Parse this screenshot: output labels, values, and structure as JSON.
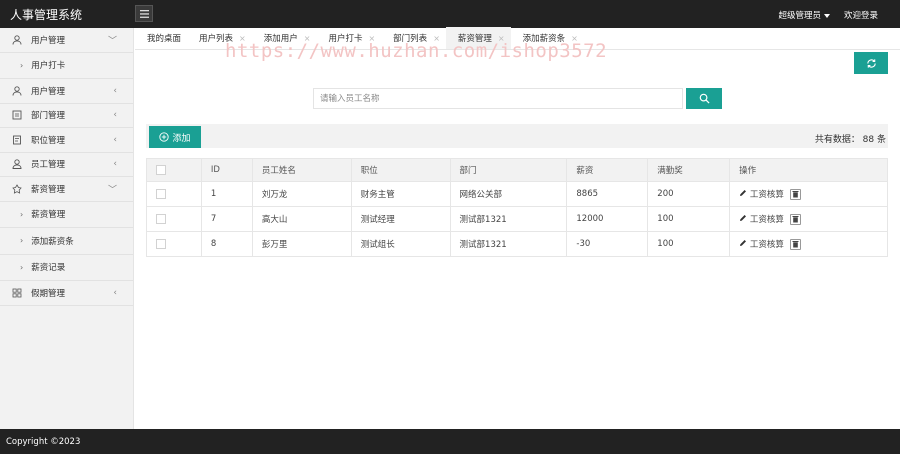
{
  "app": {
    "title": "人事管理系统"
  },
  "topbar": {
    "user_label": "超级管理员",
    "welcome_label": "欢迎登录"
  },
  "sidebar": {
    "items": [
      {
        "label": "用户管理",
        "icon": "user-icon",
        "expanded": true
      },
      {
        "label": "用户打卡",
        "sub": true
      },
      {
        "label": "用户管理",
        "icon": "user-icon",
        "expanded": false
      },
      {
        "label": "部门管理",
        "icon": "department-icon",
        "expanded": false
      },
      {
        "label": "职位管理",
        "icon": "position-icon",
        "expanded": false
      },
      {
        "label": "员工管理",
        "icon": "employee-icon",
        "expanded": false
      },
      {
        "label": "薪资管理",
        "icon": "salary-icon",
        "expanded": true
      },
      {
        "label": "薪资管理",
        "sub": true
      },
      {
        "label": "添加薪资条",
        "sub": true
      },
      {
        "label": "薪资记录",
        "sub": true
      },
      {
        "label": "假期管理",
        "icon": "grid-icon",
        "expanded": false
      }
    ]
  },
  "tabs": [
    {
      "label": "我的桌面",
      "closable": false
    },
    {
      "label": "用户列表",
      "closable": true
    },
    {
      "label": "添加用户",
      "closable": true
    },
    {
      "label": "用户打卡",
      "closable": true
    },
    {
      "label": "部门列表",
      "closable": true
    },
    {
      "label": "薪资管理",
      "closable": true,
      "active": true
    },
    {
      "label": "添加薪资条",
      "closable": true
    }
  ],
  "tab_close_glyph": "×",
  "watermark": "https://www.huzhan.com/ishop3572",
  "search": {
    "placeholder": "请输入员工名称"
  },
  "toolbar": {
    "add_label": "添加",
    "total_label": "共有数据： 88 条"
  },
  "table": {
    "headers": [
      "",
      "ID",
      "员工姓名",
      "职位",
      "部门",
      "薪资",
      "满勤奖",
      "操作"
    ],
    "rows": [
      {
        "id": "1",
        "name": "刘万龙",
        "position": "财务主管",
        "department": "网络公关部",
        "salary": "8865",
        "bonus": "200",
        "action": "工资核算"
      },
      {
        "id": "7",
        "name": "高大山",
        "position": "测试经理",
        "department": "测试部1321",
        "salary": "12000",
        "bonus": "100",
        "action": "工资核算"
      },
      {
        "id": "8",
        "name": "彭万里",
        "position": "测试组长",
        "department": "测试部1321",
        "salary": "-30",
        "bonus": "100",
        "action": "工资核算"
      }
    ]
  },
  "footer": {
    "copyright": "Copyright ©2023"
  },
  "colors": {
    "accent": "#1aa094",
    "topbar": "#222222",
    "sidebar_bg": "#f2f2f2",
    "watermark": "#f3c4c4"
  }
}
